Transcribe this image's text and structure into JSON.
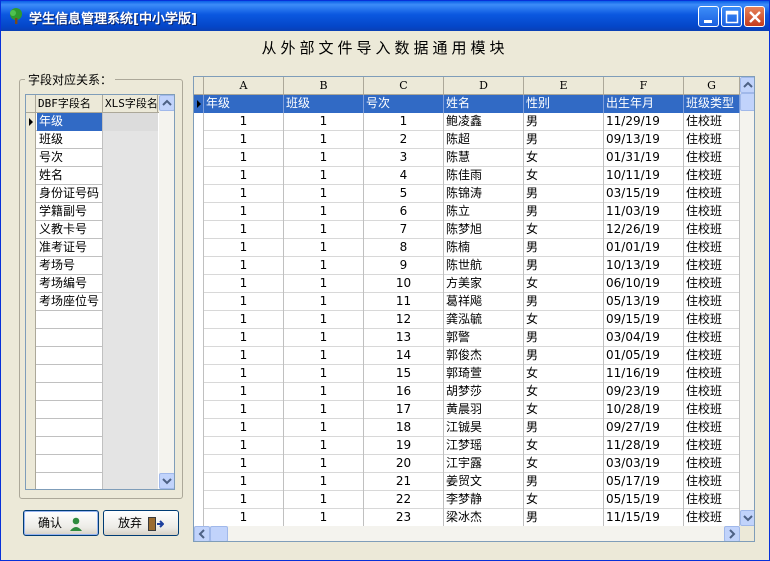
{
  "window": {
    "title": "学生信息管理系统[中小学版]",
    "module_title": "从外部文件导入数据通用模块"
  },
  "mapping": {
    "group_label": "字段对应关系：",
    "col_dbf": "DBF字段名",
    "col_xls": "XLS字段名",
    "rows": [
      {
        "dbf": "年级",
        "xls": ""
      },
      {
        "dbf": "班级",
        "xls": ""
      },
      {
        "dbf": "号次",
        "xls": ""
      },
      {
        "dbf": "姓名",
        "xls": ""
      },
      {
        "dbf": "身份证号码",
        "xls": ""
      },
      {
        "dbf": "学籍副号",
        "xls": ""
      },
      {
        "dbf": "义教卡号",
        "xls": ""
      },
      {
        "dbf": "准考证号",
        "xls": ""
      },
      {
        "dbf": "考场号",
        "xls": ""
      },
      {
        "dbf": "考场编号",
        "xls": ""
      },
      {
        "dbf": "考场座位号",
        "xls": ""
      }
    ]
  },
  "buttons": {
    "confirm": "确认",
    "cancel": "放弃"
  },
  "sheet": {
    "column_letters": [
      "A",
      "B",
      "C",
      "D",
      "E",
      "F",
      "G"
    ],
    "headers": [
      "年级",
      "班级",
      "号次",
      "姓名",
      "性别",
      "出生年月",
      "班级类型"
    ],
    "rows": [
      [
        "1",
        "1",
        "1",
        "鲍凌鑫",
        "男",
        "11/29/19",
        "住校班"
      ],
      [
        "1",
        "1",
        "2",
        "陈超",
        "男",
        "09/13/19",
        "住校班"
      ],
      [
        "1",
        "1",
        "3",
        "陈慧",
        "女",
        "01/31/19",
        "住校班"
      ],
      [
        "1",
        "1",
        "4",
        "陈佳雨",
        "女",
        "10/11/19",
        "住校班"
      ],
      [
        "1",
        "1",
        "5",
        "陈锦涛",
        "男",
        "03/15/19",
        "住校班"
      ],
      [
        "1",
        "1",
        "6",
        "陈立",
        "男",
        "11/03/19",
        "住校班"
      ],
      [
        "1",
        "1",
        "7",
        "陈梦旭",
        "女",
        "12/26/19",
        "住校班"
      ],
      [
        "1",
        "1",
        "8",
        "陈楠",
        "男",
        "01/01/19",
        "住校班"
      ],
      [
        "1",
        "1",
        "9",
        "陈世航",
        "男",
        "10/13/19",
        "住校班"
      ],
      [
        "1",
        "1",
        "10",
        "方美家",
        "女",
        "06/10/19",
        "住校班"
      ],
      [
        "1",
        "1",
        "11",
        "葛祥飚",
        "男",
        "05/13/19",
        "住校班"
      ],
      [
        "1",
        "1",
        "12",
        "龚泓毓",
        "女",
        "09/15/19",
        "住校班"
      ],
      [
        "1",
        "1",
        "13",
        "郭警",
        "男",
        "03/04/19",
        "住校班"
      ],
      [
        "1",
        "1",
        "14",
        "郭俊杰",
        "男",
        "01/05/19",
        "住校班"
      ],
      [
        "1",
        "1",
        "15",
        "郭琦萱",
        "女",
        "11/16/19",
        "住校班"
      ],
      [
        "1",
        "1",
        "16",
        "胡梦莎",
        "女",
        "09/23/19",
        "住校班"
      ],
      [
        "1",
        "1",
        "17",
        "黄晨羽",
        "女",
        "10/28/19",
        "住校班"
      ],
      [
        "1",
        "1",
        "18",
        "江铖昊",
        "男",
        "09/27/19",
        "住校班"
      ],
      [
        "1",
        "1",
        "19",
        "江梦瑶",
        "女",
        "11/28/19",
        "住校班"
      ],
      [
        "1",
        "1",
        "20",
        "江宇露",
        "女",
        "03/03/19",
        "住校班"
      ],
      [
        "1",
        "1",
        "21",
        "姜贸文",
        "男",
        "05/17/19",
        "住校班"
      ],
      [
        "1",
        "1",
        "22",
        "李梦静",
        "女",
        "05/15/19",
        "住校班"
      ],
      [
        "1",
        "1",
        "23",
        "梁冰杰",
        "男",
        "11/15/19",
        "住校班"
      ]
    ]
  },
  "icons": {
    "app": "tree-icon",
    "confirm": "user-icon",
    "cancel": "exit-door-icon"
  },
  "colors": {
    "title_bar": "#0a5fe6",
    "selection": "#316ac5",
    "window_bg": "#ece9d8"
  }
}
